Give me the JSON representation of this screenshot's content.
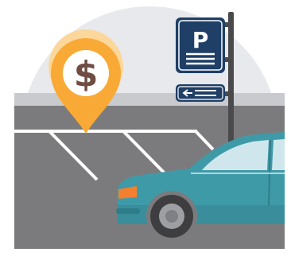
{
  "illustration": {
    "parking_sign": {
      "letter": "P",
      "icon": "parking-sign-icon",
      "arrow_icon": "arrow-left-icon"
    },
    "price_pin": {
      "symbol": "$",
      "icon": "map-pin-dollar-icon"
    },
    "car": {
      "icon": "car-icon"
    }
  },
  "colors": {
    "sky_circle": "#e8e9ed",
    "curb": "#c9cacd",
    "asphalt": "#7b7b7d",
    "lot_lines": "#ffffff",
    "sign_navy": "#1f3f66",
    "pole": "#4a4a4c",
    "pin_orange": "#f9a935",
    "pin_glow": "#fcd79b",
    "dollar_brown": "#6f4d43",
    "car_teal": "#3f9aa8",
    "car_window": "#cfe7ec",
    "tire": "#3e3e40",
    "hubcap": "#9d9fa3",
    "headlight": "#f37f2f"
  }
}
